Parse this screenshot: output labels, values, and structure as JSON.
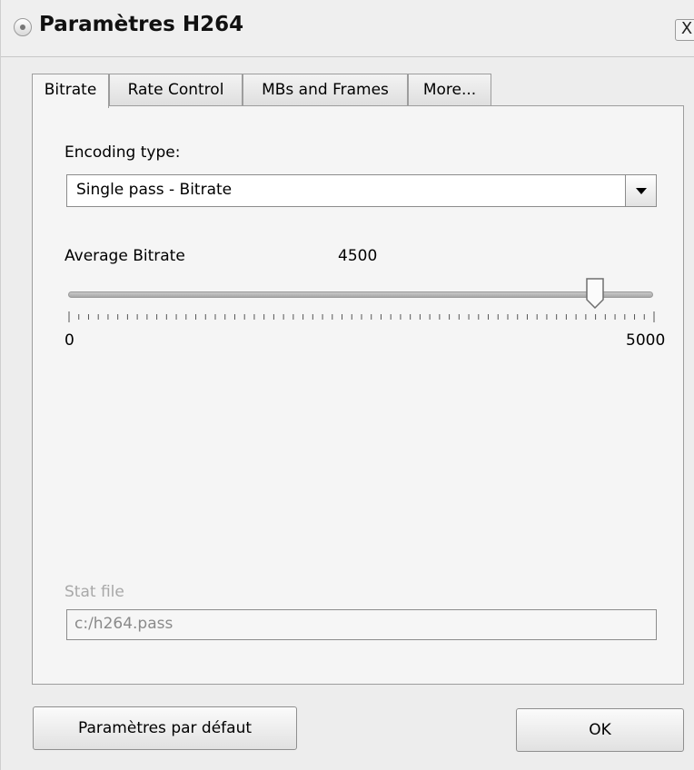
{
  "window": {
    "title": "Paramètres H264",
    "close_glyph": "X"
  },
  "tabs": [
    {
      "label": "Bitrate",
      "active": true
    },
    {
      "label": "Rate Control",
      "active": false
    },
    {
      "label": "MBs and Frames",
      "active": false
    },
    {
      "label": "More...",
      "active": false
    }
  ],
  "encoding": {
    "label": "Encoding type:",
    "selected": "Single pass - Bitrate"
  },
  "bitrate": {
    "label": "Average Bitrate",
    "value": "4500",
    "min_label": "0",
    "max_label": "5000",
    "fraction": 0.9
  },
  "stat_file": {
    "label": "Stat file",
    "value": "c:/h264.pass"
  },
  "buttons": {
    "defaults": "Paramètres par défaut",
    "ok": "OK"
  },
  "icons": {
    "title": "window-menu-icon",
    "dropdown": "chevron-down-icon",
    "close": "close-icon"
  }
}
